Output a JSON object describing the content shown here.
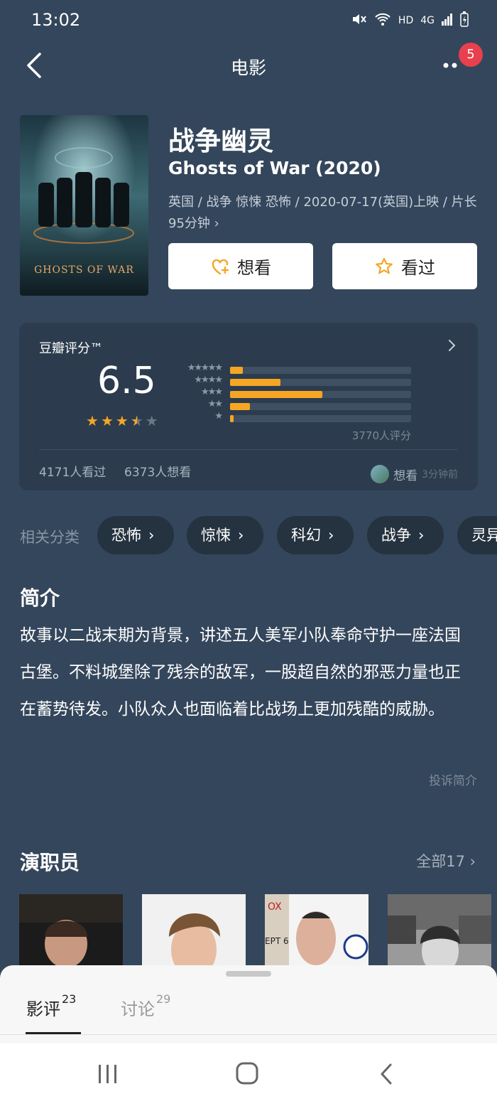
{
  "status_bar": {
    "time": "13:02",
    "network": "HD",
    "cell": "4G"
  },
  "nav": {
    "title": "电影",
    "badge": "5"
  },
  "movie": {
    "title_zh": "战争幽灵",
    "title_en": "Ghosts of War (2020)",
    "meta": "英国 / 战争 惊悚 恐怖 / 2020-07-17(英国)上映 / 片长95分钟 ›",
    "poster_text": "GHOSTS OF WAR"
  },
  "buttons": {
    "want": "想看",
    "seen": "看过"
  },
  "rating": {
    "label": "豆瓣评分™",
    "score": "6.5",
    "stars_value": 3.25,
    "distribution": [
      {
        "stars": "★★★★★",
        "percent": 7
      },
      {
        "stars": "★★★★",
        "percent": 28
      },
      {
        "stars": "★★★",
        "percent": 51
      },
      {
        "stars": "★★",
        "percent": 11
      },
      {
        "stars": "★",
        "percent": 2
      }
    ],
    "count": "3770人评分",
    "watched": "4171人看过",
    "wanting": "6373人想看",
    "friend_action": "想看",
    "friend_time": "3分钟前"
  },
  "tags": {
    "label": "相关分类",
    "items": [
      "恐怖",
      "惊悚",
      "科幻",
      "战争",
      "灵异"
    ]
  },
  "intro": {
    "title": "简介",
    "text": "故事以二战末期为背景，讲述五人美军小队奉命守护一座法国古堡。不料城堡除了残余的敌军，一股超自然的邪恶力量也正在蓄势待发。小队众人也面临着比战场上更加残酷的威胁。",
    "report": "投诉简介"
  },
  "cast": {
    "title": "演职员",
    "all": "全部17 ›"
  },
  "sheet": {
    "tabs": [
      {
        "label": "影评",
        "count": "23"
      },
      {
        "label": "讨论",
        "count": "29"
      }
    ]
  },
  "colors": {
    "background": "#34465b",
    "accent": "#f5a623",
    "badge": "#e8404e"
  }
}
